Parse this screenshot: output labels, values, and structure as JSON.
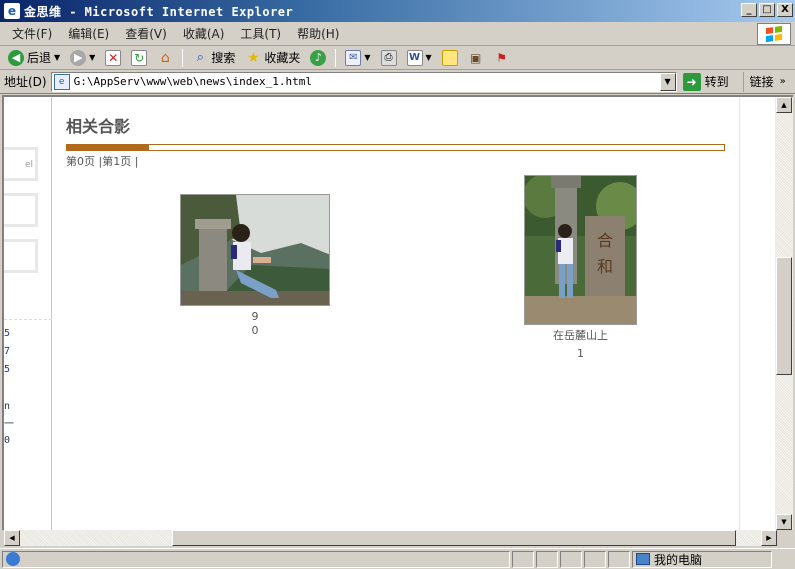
{
  "window": {
    "title": "金思维 - Microsoft Internet Explorer",
    "minimize": "_",
    "maximize": "□",
    "close": "X"
  },
  "menu": [
    "文件(F)",
    "编辑(E)",
    "查看(V)",
    "收藏(A)",
    "工具(T)",
    "帮助(H)"
  ],
  "toolbar": {
    "back": "后退",
    "search": "搜索",
    "favorites": "收藏夹"
  },
  "address": {
    "label": "地址(D)",
    "url": "G:\\AppServ\\www\\web\\news\\index_1.html",
    "go": "转到",
    "links": "链接"
  },
  "left_frame": {
    "chars": [
      "5",
      "7",
      "5",
      "n",
      "一",
      "0"
    ],
    "box_label": "el"
  },
  "content": {
    "section_title": "相关合影",
    "pager": "第0页  |第1页  |",
    "photos": [
      {
        "line1": "9",
        "line2": "0"
      },
      {
        "line1": "在岳麓山上",
        "line2": "1"
      }
    ]
  },
  "status": {
    "zone": "我的电脑"
  }
}
